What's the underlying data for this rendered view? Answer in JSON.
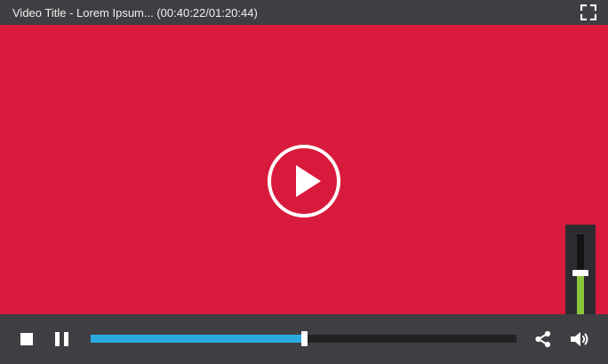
{
  "player": {
    "title": "Video Title - Lorem Ipsum... (00:40:22/01:20:44)",
    "progress_fraction": 0.5,
    "volume_fraction": 0.52
  },
  "colors": {
    "video_background": "#d81b3c",
    "chrome": "#3f3f43",
    "progress": "#29abe2",
    "volume": "#8cc63f"
  },
  "icons": {
    "fullscreen": "fullscreen-icon",
    "play": "play-circle-icon",
    "stop": "stop-icon",
    "pause": "pause-icon",
    "share": "share-icon",
    "volume": "speaker-icon"
  }
}
